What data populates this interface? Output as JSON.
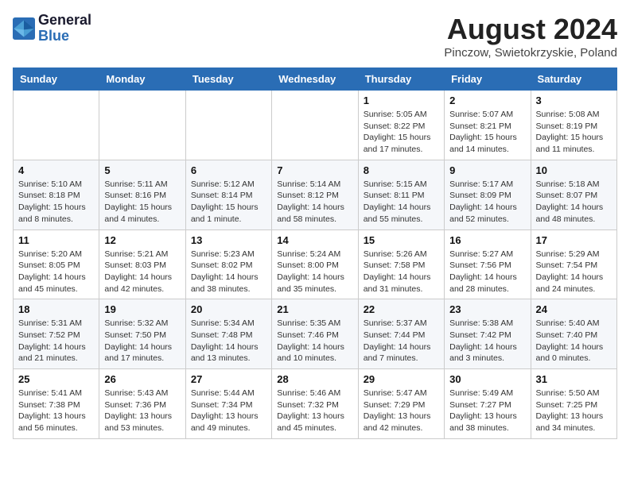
{
  "header": {
    "logo_line1": "General",
    "logo_line2": "Blue",
    "month_year": "August 2024",
    "location": "Pinczow, Swietokrzyskie, Poland"
  },
  "weekdays": [
    "Sunday",
    "Monday",
    "Tuesday",
    "Wednesday",
    "Thursday",
    "Friday",
    "Saturday"
  ],
  "weeks": [
    [
      {
        "day": "",
        "info": ""
      },
      {
        "day": "",
        "info": ""
      },
      {
        "day": "",
        "info": ""
      },
      {
        "day": "",
        "info": ""
      },
      {
        "day": "1",
        "info": "Sunrise: 5:05 AM\nSunset: 8:22 PM\nDaylight: 15 hours\nand 17 minutes."
      },
      {
        "day": "2",
        "info": "Sunrise: 5:07 AM\nSunset: 8:21 PM\nDaylight: 15 hours\nand 14 minutes."
      },
      {
        "day": "3",
        "info": "Sunrise: 5:08 AM\nSunset: 8:19 PM\nDaylight: 15 hours\nand 11 minutes."
      }
    ],
    [
      {
        "day": "4",
        "info": "Sunrise: 5:10 AM\nSunset: 8:18 PM\nDaylight: 15 hours\nand 8 minutes."
      },
      {
        "day": "5",
        "info": "Sunrise: 5:11 AM\nSunset: 8:16 PM\nDaylight: 15 hours\nand 4 minutes."
      },
      {
        "day": "6",
        "info": "Sunrise: 5:12 AM\nSunset: 8:14 PM\nDaylight: 15 hours\nand 1 minute."
      },
      {
        "day": "7",
        "info": "Sunrise: 5:14 AM\nSunset: 8:12 PM\nDaylight: 14 hours\nand 58 minutes."
      },
      {
        "day": "8",
        "info": "Sunrise: 5:15 AM\nSunset: 8:11 PM\nDaylight: 14 hours\nand 55 minutes."
      },
      {
        "day": "9",
        "info": "Sunrise: 5:17 AM\nSunset: 8:09 PM\nDaylight: 14 hours\nand 52 minutes."
      },
      {
        "day": "10",
        "info": "Sunrise: 5:18 AM\nSunset: 8:07 PM\nDaylight: 14 hours\nand 48 minutes."
      }
    ],
    [
      {
        "day": "11",
        "info": "Sunrise: 5:20 AM\nSunset: 8:05 PM\nDaylight: 14 hours\nand 45 minutes."
      },
      {
        "day": "12",
        "info": "Sunrise: 5:21 AM\nSunset: 8:03 PM\nDaylight: 14 hours\nand 42 minutes."
      },
      {
        "day": "13",
        "info": "Sunrise: 5:23 AM\nSunset: 8:02 PM\nDaylight: 14 hours\nand 38 minutes."
      },
      {
        "day": "14",
        "info": "Sunrise: 5:24 AM\nSunset: 8:00 PM\nDaylight: 14 hours\nand 35 minutes."
      },
      {
        "day": "15",
        "info": "Sunrise: 5:26 AM\nSunset: 7:58 PM\nDaylight: 14 hours\nand 31 minutes."
      },
      {
        "day": "16",
        "info": "Sunrise: 5:27 AM\nSunset: 7:56 PM\nDaylight: 14 hours\nand 28 minutes."
      },
      {
        "day": "17",
        "info": "Sunrise: 5:29 AM\nSunset: 7:54 PM\nDaylight: 14 hours\nand 24 minutes."
      }
    ],
    [
      {
        "day": "18",
        "info": "Sunrise: 5:31 AM\nSunset: 7:52 PM\nDaylight: 14 hours\nand 21 minutes."
      },
      {
        "day": "19",
        "info": "Sunrise: 5:32 AM\nSunset: 7:50 PM\nDaylight: 14 hours\nand 17 minutes."
      },
      {
        "day": "20",
        "info": "Sunrise: 5:34 AM\nSunset: 7:48 PM\nDaylight: 14 hours\nand 13 minutes."
      },
      {
        "day": "21",
        "info": "Sunrise: 5:35 AM\nSunset: 7:46 PM\nDaylight: 14 hours\nand 10 minutes."
      },
      {
        "day": "22",
        "info": "Sunrise: 5:37 AM\nSunset: 7:44 PM\nDaylight: 14 hours\nand 7 minutes."
      },
      {
        "day": "23",
        "info": "Sunrise: 5:38 AM\nSunset: 7:42 PM\nDaylight: 14 hours\nand 3 minutes."
      },
      {
        "day": "24",
        "info": "Sunrise: 5:40 AM\nSunset: 7:40 PM\nDaylight: 14 hours\nand 0 minutes."
      }
    ],
    [
      {
        "day": "25",
        "info": "Sunrise: 5:41 AM\nSunset: 7:38 PM\nDaylight: 13 hours\nand 56 minutes."
      },
      {
        "day": "26",
        "info": "Sunrise: 5:43 AM\nSunset: 7:36 PM\nDaylight: 13 hours\nand 53 minutes."
      },
      {
        "day": "27",
        "info": "Sunrise: 5:44 AM\nSunset: 7:34 PM\nDaylight: 13 hours\nand 49 minutes."
      },
      {
        "day": "28",
        "info": "Sunrise: 5:46 AM\nSunset: 7:32 PM\nDaylight: 13 hours\nand 45 minutes."
      },
      {
        "day": "29",
        "info": "Sunrise: 5:47 AM\nSunset: 7:29 PM\nDaylight: 13 hours\nand 42 minutes."
      },
      {
        "day": "30",
        "info": "Sunrise: 5:49 AM\nSunset: 7:27 PM\nDaylight: 13 hours\nand 38 minutes."
      },
      {
        "day": "31",
        "info": "Sunrise: 5:50 AM\nSunset: 7:25 PM\nDaylight: 13 hours\nand 34 minutes."
      }
    ]
  ]
}
